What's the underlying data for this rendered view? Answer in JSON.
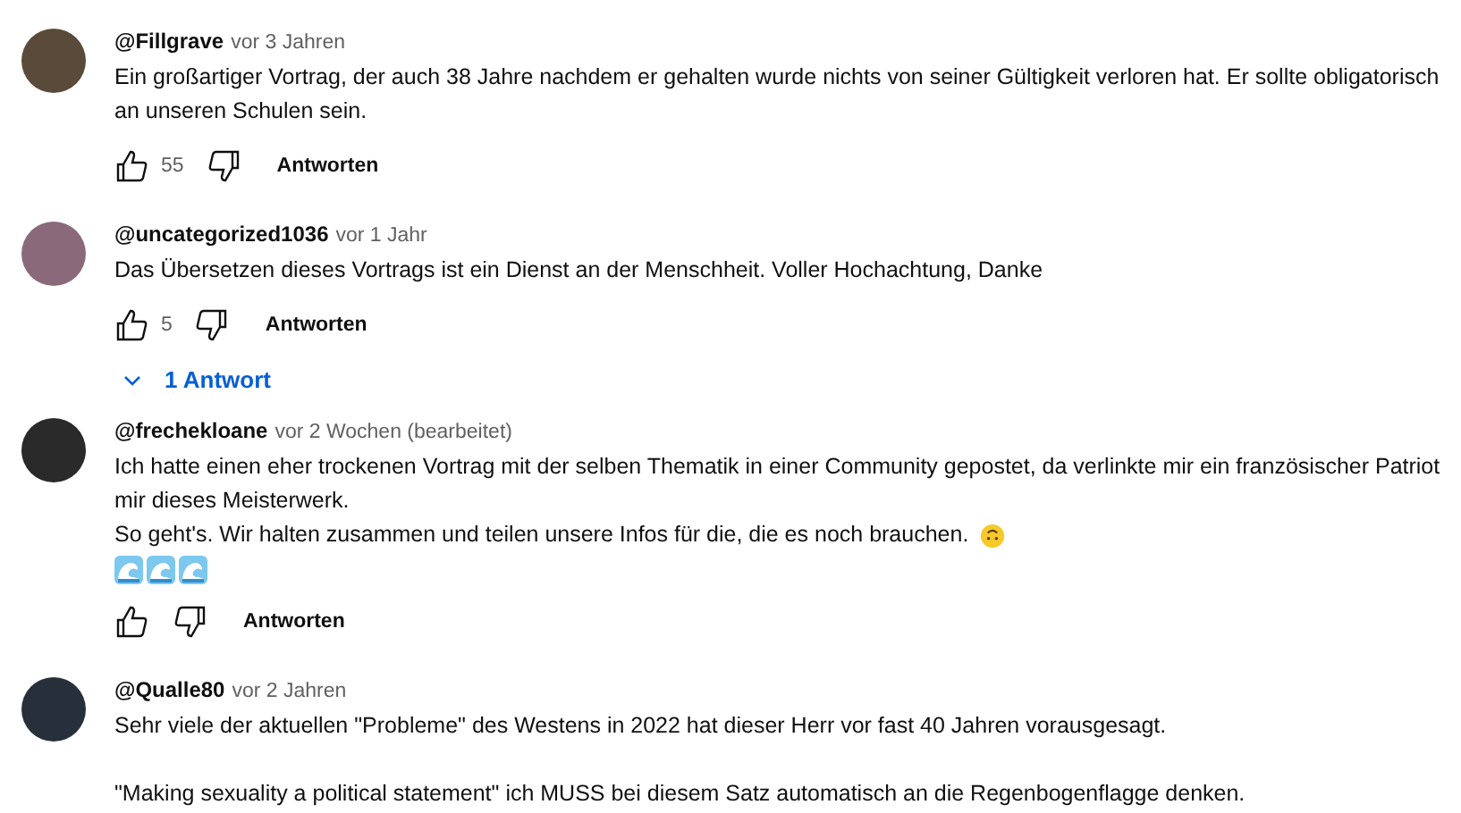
{
  "comments": [
    {
      "author": "@Fillgrave",
      "time": "vor 3 Jahren",
      "lines": [
        {
          "kind": "text",
          "text": "Ein großartiger Vortrag, der auch 38 Jahre nachdem er gehalten wurde nichts von seiner Gültigkeit verloren hat. Er sollte obligatorisch"
        },
        {
          "kind": "text",
          "text": "an unseren Schulen sein."
        }
      ],
      "likes": "55",
      "reply_label": "Antworten"
    },
    {
      "author": "@uncategorized1036",
      "time": "vor 1 Jahr",
      "lines": [
        {
          "kind": "text",
          "text": "Das Übersetzen dieses Vortrags ist ein Dienst an der Menschheit. Voller Hochachtung, Danke"
        }
      ],
      "likes": "5",
      "reply_label": "Antworten",
      "replies_toggle": {
        "label": "1 Antwort",
        "expanded": false
      }
    },
    {
      "author": "@frechekloane",
      "time": "vor 2 Wochen (bearbeitet)",
      "lines": [
        {
          "kind": "text",
          "text": "Ich hatte einen eher trockenen Vortrag mit der selben Thematik in einer Community gepostet, da verlinkte mir ein französischer Patriot"
        },
        {
          "kind": "text",
          "text": "mir dieses Meisterwerk."
        },
        {
          "kind": "text-face",
          "text": "So geht's. Wir halten zusammen und teilen unsere Infos für die, die es noch brauchen."
        },
        {
          "kind": "waves"
        }
      ],
      "reply_label": "Antworten"
    },
    {
      "author": "@Qualle80",
      "time": "vor 2 Jahren",
      "lines": [
        {
          "kind": "text",
          "text": "Sehr viele der aktuellen \"Probleme\" des Westens in 2022 hat dieser Herr vor fast 40 Jahren vorausgesagt."
        },
        {
          "kind": "blank"
        },
        {
          "kind": "text",
          "text": "\"Making sexuality a political statement\" ich MUSS bei diesem Satz automatisch an die Regenbogenflagge denken."
        }
      ]
    }
  ]
}
